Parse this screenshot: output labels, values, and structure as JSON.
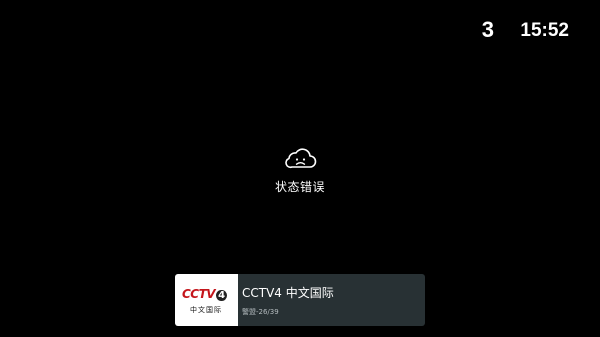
{
  "status_bar": {
    "channel_number": "3",
    "time": "15:52"
  },
  "error": {
    "icon": "sad-cloud-icon",
    "message": "状态错误"
  },
  "channel_info": {
    "logo": {
      "brand_text": "CCTV",
      "number": "4",
      "subtitle": "中文国际"
    },
    "name": "CCTV4 中文国际",
    "program": "警盟-26/39"
  },
  "colors": {
    "background": "#000000",
    "bar_background": "#283134",
    "logo_red": "#c4161c",
    "text_primary": "#ffffff",
    "text_secondary": "#b5bcbf"
  }
}
